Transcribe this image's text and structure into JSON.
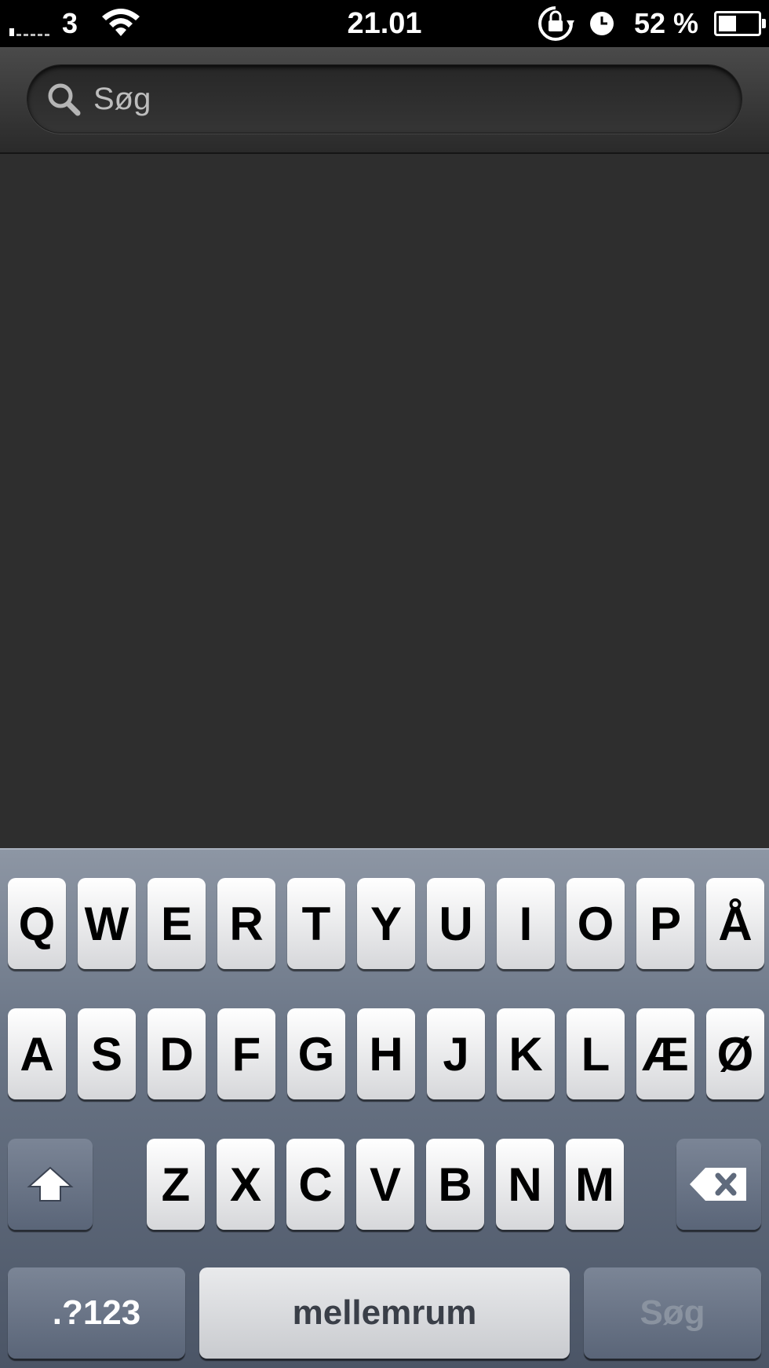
{
  "status_bar": {
    "carrier": "3",
    "time": "21.01",
    "battery_percent": "52 %",
    "battery_level": 0.52,
    "icons": [
      "signal-icon",
      "wifi-icon",
      "rotation-lock-icon",
      "alarm-clock-icon",
      "battery-icon"
    ]
  },
  "search": {
    "placeholder": "Søg",
    "value": ""
  },
  "keyboard": {
    "row1": [
      "Q",
      "W",
      "E",
      "R",
      "T",
      "Y",
      "U",
      "I",
      "O",
      "P",
      "Å"
    ],
    "row2": [
      "A",
      "S",
      "D",
      "F",
      "G",
      "H",
      "J",
      "K",
      "L",
      "Æ",
      "Ø"
    ],
    "row3": [
      "Z",
      "X",
      "C",
      "V",
      "B",
      "N",
      "M"
    ],
    "numbers_label": ".?123",
    "space_label": "mellemrum",
    "search_label": "Søg",
    "icons": [
      "shift-icon",
      "backspace-icon"
    ]
  },
  "colors": {
    "background": "#2e2e2e",
    "status_bar": "#000000",
    "keyboard_top": "#8d96a4",
    "keyboard_bottom": "#4b5566"
  }
}
